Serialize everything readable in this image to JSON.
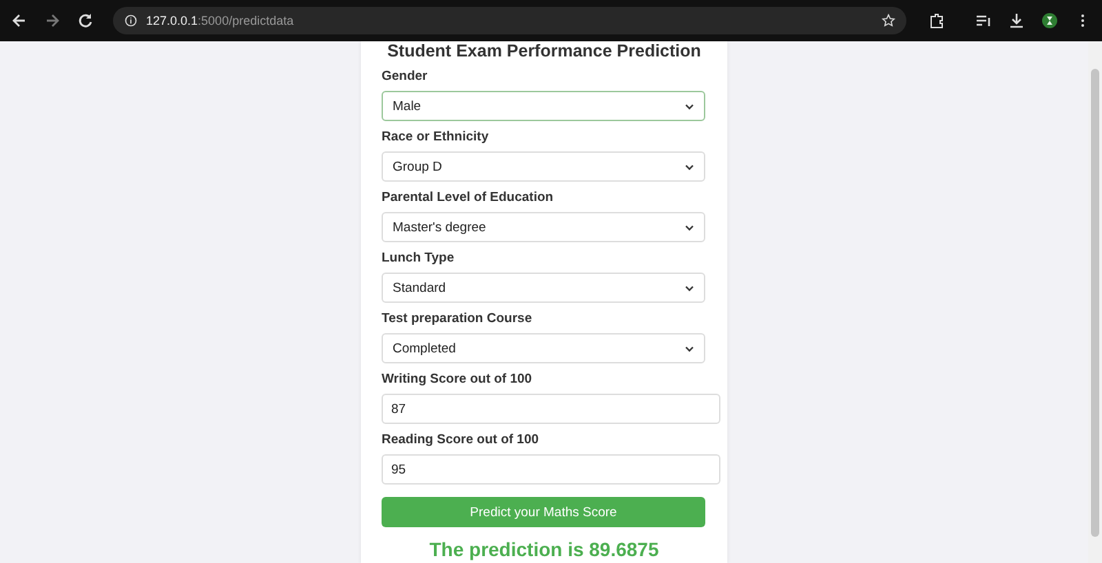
{
  "browser": {
    "url_host": "127.0.0.1",
    "url_path": ":5000/predictdata"
  },
  "form": {
    "title": "Student Exam Performance Prediction",
    "fields": [
      {
        "kind": "select",
        "label": "Gender",
        "value": "Male",
        "focused": true
      },
      {
        "kind": "select",
        "label": "Race or Ethnicity",
        "value": "Group D",
        "focused": false
      },
      {
        "kind": "select",
        "label": "Parental Level of Education",
        "value": "Master's degree",
        "focused": false
      },
      {
        "kind": "select",
        "label": "Lunch Type",
        "value": "Standard",
        "focused": false
      },
      {
        "kind": "select",
        "label": "Test preparation Course",
        "value": "Completed",
        "focused": false
      },
      {
        "kind": "input",
        "label": "Writing Score out of 100",
        "value": "87",
        "focused": false
      },
      {
        "kind": "input",
        "label": "Reading Score out of 100",
        "value": "95",
        "focused": false
      }
    ],
    "submit": "Predict your Maths Score",
    "result": "The prediction is 89.6875"
  }
}
